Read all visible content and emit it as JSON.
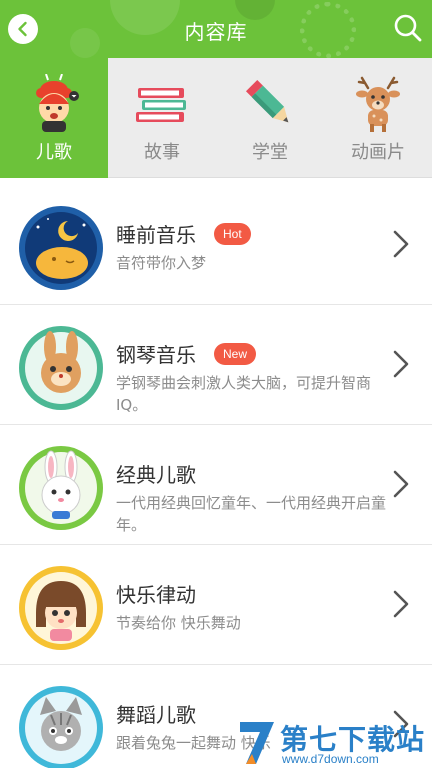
{
  "header": {
    "title": "内容库",
    "back_icon": "back-arrow-icon",
    "search_icon": "search-icon",
    "color": "#6cc23a"
  },
  "tabs": [
    {
      "label": "儿歌",
      "icon": "singing-doll-icon",
      "active": true
    },
    {
      "label": "故事",
      "icon": "books-icon",
      "active": false
    },
    {
      "label": "学堂",
      "icon": "pencil-icon",
      "active": false
    },
    {
      "label": "动画片",
      "icon": "deer-icon",
      "active": false
    }
  ],
  "items": [
    {
      "title": "睡前音乐",
      "badge": "Hot",
      "desc": "音符带你入梦",
      "avatar": "sleeping-moon-icon"
    },
    {
      "title": "钢琴音乐",
      "badge": "New",
      "desc": "学钢琴曲会刺激人类大脑，可提升智商IQ。",
      "avatar": "rabbit-cartoon-icon"
    },
    {
      "title": "经典儿歌",
      "badge": "",
      "desc": "一代用经典回忆童年、一代用经典开启童年。",
      "avatar": "white-bunny-icon"
    },
    {
      "title": "快乐律动",
      "badge": "",
      "desc": "节奏给你 快乐舞动",
      "avatar": "girl-cartoon-icon"
    },
    {
      "title": "舞蹈儿歌",
      "badge": "",
      "desc": "跟着兔兔一起舞动 快乐",
      "avatar": "gray-cat-icon"
    }
  ],
  "watermark": {
    "text": "第七下载站",
    "url": "www.d7down.com"
  },
  "colors": {
    "accent": "#6cc23a",
    "badge": "#f25a44",
    "watermark": "#2a80c8"
  }
}
